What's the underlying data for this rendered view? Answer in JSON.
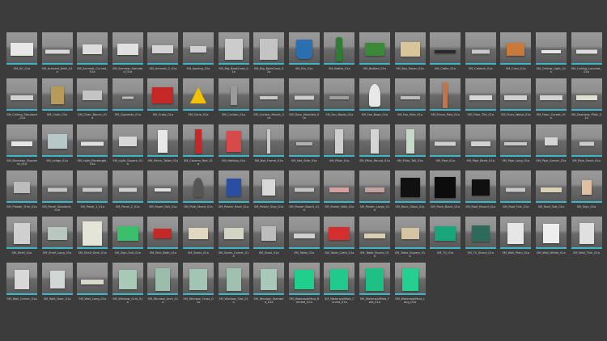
{
  "assets": [
    {
      "label": "SM_AC_01a",
      "shape": "box",
      "color": "#e8e8e8",
      "w": 28,
      "h": 16
    },
    {
      "label": "SM_Armrest_Bath_01a",
      "shape": "flat",
      "color": "#d8d8d8",
      "w": 30,
      "h": 5
    },
    {
      "label": "SM_Armrest_Curved_01a",
      "shape": "box",
      "color": "#dcdcdc",
      "w": 24,
      "h": 12
    },
    {
      "label": "SM_Armrest_Standard_01a",
      "shape": "box",
      "color": "#e0e0e0",
      "w": 26,
      "h": 14
    },
    {
      "label": "SM_Armrest_2_01a",
      "shape": "box",
      "color": "#d4d4d4",
      "w": 26,
      "h": 10
    },
    {
      "label": "SM_Awning_01a",
      "shape": "box",
      "color": "#cfcfcf",
      "w": 20,
      "h": 8
    },
    {
      "label": "SM_Big_BookCase_01a",
      "shape": "box",
      "color": "#cccccc",
      "w": 22,
      "h": 26
    },
    {
      "label": "SM_Big_BookCase_02a",
      "shape": "box",
      "color": "#c4c4c4",
      "w": 22,
      "h": 26
    },
    {
      "label": "SM_Bin_01a",
      "shape": "bin",
      "color": "#2c6fb0",
      "w": 20,
      "h": 24
    },
    {
      "label": "SM_Bottle_01a",
      "shape": "bottle",
      "color": "#2e7d32",
      "w": 8,
      "h": 30
    },
    {
      "label": "SM_Bottles_01a",
      "shape": "box",
      "color": "#3a8a3a",
      "w": 24,
      "h": 16
    },
    {
      "label": "SM_Box_Paper_01a",
      "shape": "box",
      "color": "#d8c69a",
      "w": 24,
      "h": 18
    },
    {
      "label": "SM_Cable_01a",
      "shape": "flat",
      "color": "#2a2a2a",
      "w": 26,
      "h": 4
    },
    {
      "label": "SM_Cabinet_01a",
      "shape": "flat",
      "color": "#c8c8c8",
      "w": 22,
      "h": 5
    },
    {
      "label": "SM_Cans_01a",
      "shape": "box",
      "color": "#c97a3a",
      "w": 22,
      "h": 16
    },
    {
      "label": "SM_Ceiling_Light_01a",
      "shape": "flat",
      "color": "#e6e6e6",
      "w": 24,
      "h": 4
    },
    {
      "label": "SM_Ceiling_Louvred_01a",
      "shape": "flat",
      "color": "#dcdcdc",
      "w": 26,
      "h": 5
    },
    {
      "label": "SM_Ceiling_Standard_01a",
      "shape": "flat",
      "color": "#d0d0d0",
      "w": 28,
      "h": 6
    },
    {
      "label": "SM_Chair_01a",
      "shape": "box",
      "color": "#b89a5a",
      "w": 16,
      "h": 22
    },
    {
      "label": "SM_Chair_Bench_01a",
      "shape": "box",
      "color": "#c4c4c4",
      "w": 24,
      "h": 12
    },
    {
      "label": "SM_Cigarette_01a",
      "shape": "flat",
      "color": "#bdbdbd",
      "w": 14,
      "h": 3
    },
    {
      "label": "SM_Crate_01a",
      "shape": "box",
      "color": "#c62828",
      "w": 26,
      "h": 20
    },
    {
      "label": "SM_Cone_01a",
      "shape": "cone",
      "color": "#f2c200",
      "w": 20,
      "h": 20
    },
    {
      "label": "SM_Curtain_01a",
      "shape": "box",
      "color": "#9a9a9a",
      "w": 8,
      "h": 24
    },
    {
      "label": "SM_Curtain_Mount_01a",
      "shape": "flat",
      "color": "#c8c8c8",
      "w": 22,
      "h": 4
    },
    {
      "label": "SM_Door_Moulded_01a",
      "shape": "flat",
      "color": "#cccccc",
      "w": 24,
      "h": 5
    },
    {
      "label": "SM_Fan_Blade_01a",
      "shape": "flat",
      "color": "#9e9e9e",
      "w": 24,
      "h": 4
    },
    {
      "label": "SM_Fan_Base_01a",
      "shape": "lamp",
      "color": "#e8e8e8",
      "w": 14,
      "h": 28
    },
    {
      "label": "SM_Fan_Pole_01a",
      "shape": "flat",
      "color": "#bdbdbd",
      "w": 24,
      "h": 4
    },
    {
      "label": "SM_Fence_Pole_01a",
      "shape": "box",
      "color": "#c0764a",
      "w": 6,
      "h": 32
    },
    {
      "label": "SM_Floor_Tile_01a",
      "shape": "flat",
      "color": "#d6d6d6",
      "w": 28,
      "h": 6
    },
    {
      "label": "SM_Floor_Wood_01a",
      "shape": "flat",
      "color": "#cfcfcf",
      "w": 28,
      "h": 6
    },
    {
      "label": "SM_Floor_Carpet_01a",
      "shape": "flat",
      "color": "#d2d2d2",
      "w": 28,
      "h": 6
    },
    {
      "label": "SM_Doorway_Plain_01a",
      "shape": "flat",
      "color": "#e0e0d0",
      "w": 26,
      "h": 6
    },
    {
      "label": "SM_Doorway_Standard_01a",
      "shape": "flat",
      "color": "#e4e4e4",
      "w": 26,
      "h": 6
    },
    {
      "label": "SM_Ledge_01a",
      "shape": "box",
      "color": "#b8c8c8",
      "w": 24,
      "h": 18
    },
    {
      "label": "SM_Light_Rectangle_01a",
      "shape": "flat",
      "color": "#e0e0e0",
      "w": 28,
      "h": 5
    },
    {
      "label": "SM_Light_Square_01a",
      "shape": "box",
      "color": "#d8d8d8",
      "w": 22,
      "h": 12
    },
    {
      "label": "SM_Mirror_Toilet_01a",
      "shape": "box",
      "color": "#e8e8e8",
      "w": 12,
      "h": 28
    },
    {
      "label": "SM_Column_Red_01a",
      "shape": "box",
      "color": "#c62828",
      "w": 8,
      "h": 30
    },
    {
      "label": "SM_Netting_01a",
      "shape": "box",
      "color": "#d84a4a",
      "w": 18,
      "h": 26
    },
    {
      "label": "SM_Net_Frame_01a",
      "shape": "box",
      "color": "#c8c8c8",
      "w": 4,
      "h": 30
    },
    {
      "label": "SM_Net_Side_01a",
      "shape": "flat",
      "color": "#b0b0b0",
      "w": 20,
      "h": 4
    },
    {
      "label": "SM_Pillar_01a",
      "shape": "box",
      "color": "#cfcfcf",
      "w": 10,
      "h": 30
    },
    {
      "label": "SM_Pillar_Round_01a",
      "shape": "box",
      "color": "#d4d4d4",
      "w": 10,
      "h": 30
    },
    {
      "label": "SM_Pillar_Tall_01a",
      "shape": "box",
      "color": "#c8d8c8",
      "w": 10,
      "h": 30
    },
    {
      "label": "SM_Pipe_01a",
      "shape": "flat",
      "color": "#cfcfcf",
      "w": 26,
      "h": 5
    },
    {
      "label": "SM_Pipe_Bend_01a",
      "shape": "flat",
      "color": "#d0d0d0",
      "w": 24,
      "h": 6
    },
    {
      "label": "SM_Pipe_Long_01a",
      "shape": "flat",
      "color": "#c8c8c8",
      "w": 28,
      "h": 4
    },
    {
      "label": "SM_Pipe_Corner_01a",
      "shape": "box",
      "color": "#d4d4d4",
      "w": 16,
      "h": 10
    },
    {
      "label": "SM_Pipe_Short_01a",
      "shape": "flat",
      "color": "#cccccc",
      "w": 18,
      "h": 5
    },
    {
      "label": "SM_Plaster_Trim_01a",
      "shape": "box",
      "color": "#bcbcbc",
      "w": 20,
      "h": 14
    },
    {
      "label": "SM_Panel_Standard_01a",
      "shape": "flat",
      "color": "#c4c4c4",
      "w": 24,
      "h": 5
    },
    {
      "label": "SM_Panel_1_01a",
      "shape": "flat",
      "color": "#c8c8c8",
      "w": 24,
      "h": 5
    },
    {
      "label": "SM_Panel_2_01a",
      "shape": "flat",
      "color": "#d0d0d0",
      "w": 22,
      "h": 5
    },
    {
      "label": "SM_Paper_Roll_01a",
      "shape": "flat",
      "color": "#e0e0e0",
      "w": 20,
      "h": 4
    },
    {
      "label": "SM_Pole_Stand_01a",
      "shape": "lamp",
      "color": "#555555",
      "w": 12,
      "h": 24
    },
    {
      "label": "SM_Poster_Rack_01a",
      "shape": "box",
      "color": "#2a4fa0",
      "w": 18,
      "h": 22
    },
    {
      "label": "SM_Poster_Sign_01a",
      "shape": "box",
      "color": "#d8d8d8",
      "w": 16,
      "h": 20
    },
    {
      "label": "SM_Poster_Board_01a",
      "shape": "flat",
      "color": "#c4c4c4",
      "w": 24,
      "h": 5
    },
    {
      "label": "SM_Poster_Wall_01a",
      "shape": "flat",
      "color": "#d4a0a0",
      "w": 24,
      "h": 6
    },
    {
      "label": "SM_Poster_Large_01a",
      "shape": "flat",
      "color": "#c0a0a0",
      "w": 24,
      "h": 6
    },
    {
      "label": "SM_Rack_Glass_01a",
      "shape": "box",
      "color": "#111111",
      "w": 24,
      "h": 24
    },
    {
      "label": "SM_Rack_Black_01a",
      "shape": "box",
      "color": "#0c0c0c",
      "w": 26,
      "h": 26
    },
    {
      "label": "SM_Roof_Round_01a",
      "shape": "box",
      "color": "#101010",
      "w": 22,
      "h": 20
    },
    {
      "label": "SM_Roof_Flat_01a",
      "shape": "flat",
      "color": "#c8c8c8",
      "w": 24,
      "h": 5
    },
    {
      "label": "SM_Roof_Slat_01a",
      "shape": "flat",
      "color": "#d8d0b8",
      "w": 26,
      "h": 6
    },
    {
      "label": "SM_Sign_01a",
      "shape": "box",
      "color": "#e0c0a0",
      "w": 12,
      "h": 18
    },
    {
      "label": "SM_Shelf_01a",
      "shape": "box",
      "color": "#d0d0d0",
      "w": 20,
      "h": 26
    },
    {
      "label": "SM_Shelf_Long_01a",
      "shape": "box",
      "color": "#b8c8c0",
      "w": 24,
      "h": 16
    },
    {
      "label": "SM_Shelf_Dark_01a",
      "shape": "box",
      "color": "#e4e4d8",
      "w": 24,
      "h": 30
    },
    {
      "label": "SM_Sign_Exit_01a",
      "shape": "box",
      "color": "#3cbf6a",
      "w": 26,
      "h": 18
    },
    {
      "label": "SM_Sink_Bath_01a",
      "shape": "box",
      "color": "#c62828",
      "w": 22,
      "h": 12
    },
    {
      "label": "SM_Stairs_01a",
      "shape": "box",
      "color": "#e0d8c0",
      "w": 24,
      "h": 14
    },
    {
      "label": "SM_Stairs_Corner_01a",
      "shape": "box",
      "color": "#d4d4c4",
      "w": 24,
      "h": 14
    },
    {
      "label": "SM_Stool_01a",
      "shape": "box",
      "color": "#bdbdbd",
      "w": 18,
      "h": 18
    },
    {
      "label": "SM_Table_01a",
      "shape": "flat",
      "color": "#d0d0d0",
      "w": 26,
      "h": 6
    },
    {
      "label": "SM_Table_Cloth_01a",
      "shape": "box",
      "color": "#d32f2f",
      "w": 26,
      "h": 16
    },
    {
      "label": "SM_Table_Round_01a",
      "shape": "flat",
      "color": "#d8d0b0",
      "w": 26,
      "h": 6
    },
    {
      "label": "SM_Table_Square_01a",
      "shape": "box",
      "color": "#d4c4a4",
      "w": 22,
      "h": 14
    },
    {
      "label": "SM_TV_01a",
      "shape": "box",
      "color": "#1aa57a",
      "w": 26,
      "h": 18
    },
    {
      "label": "SM_TV_Stand_01a",
      "shape": "box",
      "color": "#2d6a5a",
      "w": 22,
      "h": 20
    },
    {
      "label": "SM_Wall_Plain_01a",
      "shape": "box",
      "color": "#e6e6e6",
      "w": 20,
      "h": 26
    },
    {
      "label": "SM_Wall_White_01a",
      "shape": "box",
      "color": "#eeeeee",
      "w": 20,
      "h": 24
    },
    {
      "label": "SM_Wall_Thin_01a",
      "shape": "box",
      "color": "#e0e0e0",
      "w": 18,
      "h": 26
    },
    {
      "label": "SM_Wall_Corner_01a",
      "shape": "box",
      "color": "#d8d8d8",
      "w": 18,
      "h": 24
    },
    {
      "label": "SM_Wall_Door_01a",
      "shape": "box",
      "color": "#cfd8d4",
      "w": 18,
      "h": 22
    },
    {
      "label": "SM_Wall_Long_01a",
      "shape": "flat",
      "color": "#d8d8c8",
      "w": 28,
      "h": 6
    },
    {
      "label": "SM_Window_Grid_01a",
      "shape": "box",
      "color": "#a8c8b8",
      "w": 22,
      "h": 24
    },
    {
      "label": "SM_Window_Arch_01a",
      "shape": "box",
      "color": "#9cbcac",
      "w": 18,
      "h": 28
    },
    {
      "label": "SM_Window_Cross_01a",
      "shape": "box",
      "color": "#a4c4b4",
      "w": 22,
      "h": 26
    },
    {
      "label": "SM_Window_Slat_01a",
      "shape": "box",
      "color": "#a0c0b0",
      "w": 18,
      "h": 28
    },
    {
      "label": "SM_Window_Standard_01a",
      "shape": "box",
      "color": "#a8c8b8",
      "w": 20,
      "h": 26
    },
    {
      "label": "SM_WaterwallMod_Bended_01a",
      "shape": "box",
      "color": "#1fcf8a",
      "w": 24,
      "h": 24
    },
    {
      "label": "SM_WaterwallMod_Curved_01a",
      "shape": "box",
      "color": "#22c98c",
      "w": 22,
      "h": 26
    },
    {
      "label": "SM_WaterwallMod_Fold_01a",
      "shape": "box",
      "color": "#1fc085",
      "w": 22,
      "h": 28
    },
    {
      "label": "SM_WaterwallMod_Long_01a",
      "shape": "box",
      "color": "#24d090",
      "w": 20,
      "h": 28
    }
  ]
}
